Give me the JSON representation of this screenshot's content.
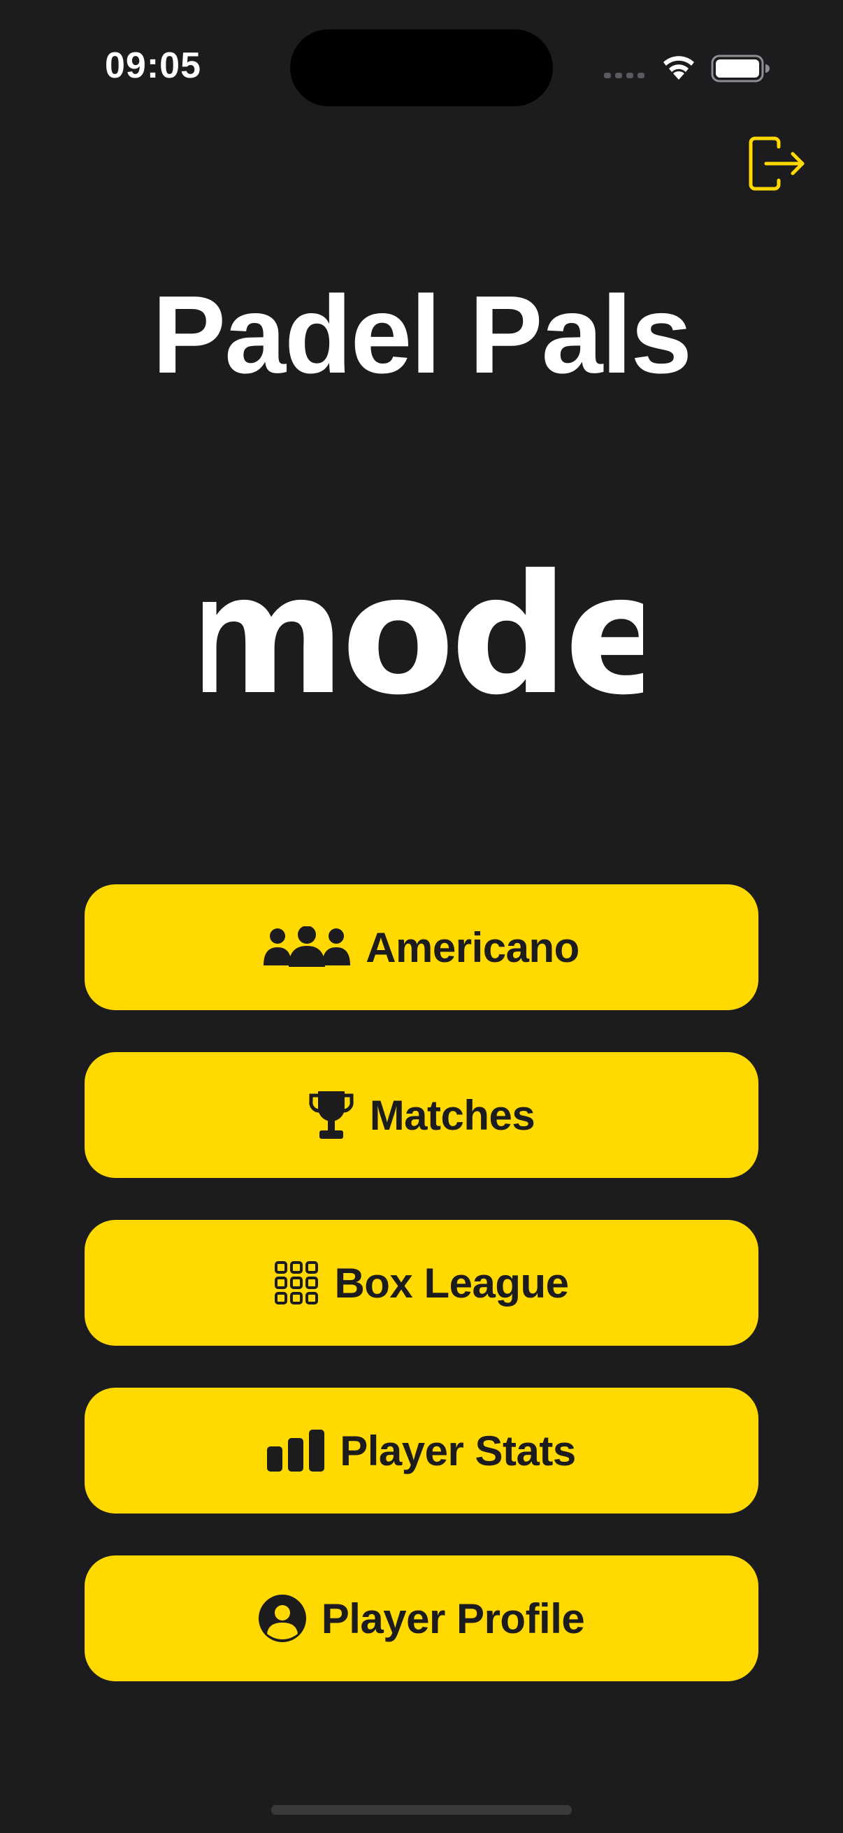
{
  "status_bar": {
    "time": "09:05",
    "battery_level": 1.0,
    "icons": [
      "cellular-icon",
      "wifi-icon",
      "battery-icon"
    ]
  },
  "header": {
    "logout_icon": "logout-icon",
    "title": "Padel Pals"
  },
  "logo": {
    "text": "mode"
  },
  "menu": {
    "items": [
      {
        "label": "Americano",
        "icon": "group-icon"
      },
      {
        "label": "Matches",
        "icon": "trophy-icon"
      },
      {
        "label": "Box League",
        "icon": "grid-icon"
      },
      {
        "label": "Player Stats",
        "icon": "bar-chart-icon"
      },
      {
        "label": "Player Profile",
        "icon": "person-circle-icon"
      }
    ]
  },
  "colors": {
    "background": "#1c1c1e",
    "accent": "#ffd900",
    "button_text": "#1c1c1e",
    "title_text": "#ffffff"
  }
}
